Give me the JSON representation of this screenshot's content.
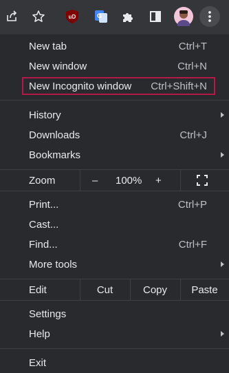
{
  "toolbar": {
    "icons": [
      "share-icon",
      "star-icon",
      "ublock-icon",
      "translate-icon",
      "extensions-icon",
      "side-panel-icon",
      "avatar",
      "more-menu-icon"
    ],
    "ublock_text": "uD",
    "translate_text": "G"
  },
  "menu": {
    "new_tab": {
      "label": "New tab",
      "shortcut": "Ctrl+T"
    },
    "new_window": {
      "label": "New window",
      "shortcut": "Ctrl+N"
    },
    "new_incognito": {
      "label": "New Incognito window",
      "shortcut": "Ctrl+Shift+N"
    },
    "history": {
      "label": "History"
    },
    "downloads": {
      "label": "Downloads",
      "shortcut": "Ctrl+J"
    },
    "bookmarks": {
      "label": "Bookmarks"
    },
    "zoom": {
      "label": "Zoom",
      "minus": "–",
      "value": "100%",
      "plus": "+"
    },
    "print": {
      "label": "Print...",
      "shortcut": "Ctrl+P"
    },
    "cast": {
      "label": "Cast..."
    },
    "find": {
      "label": "Find...",
      "shortcut": "Ctrl+F"
    },
    "more_tools": {
      "label": "More tools"
    },
    "edit": {
      "label": "Edit",
      "cut": "Cut",
      "copy": "Copy",
      "paste": "Paste"
    },
    "settings": {
      "label": "Settings"
    },
    "help": {
      "label": "Help"
    },
    "exit": {
      "label": "Exit"
    }
  },
  "colors": {
    "menu_bg": "#292a2d",
    "toolbar_bg": "#35363a",
    "highlight_border": "#b3194b",
    "text": "#e8eaed"
  }
}
